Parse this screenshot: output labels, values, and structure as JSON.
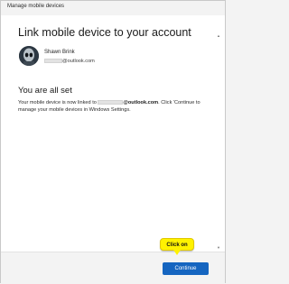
{
  "window": {
    "title": "Manage mobile devices"
  },
  "main": {
    "heading": "Link mobile device to your account",
    "account": {
      "name": "Shawn Brink",
      "email_domain": "@outlook.com"
    },
    "status_heading": "You are all set",
    "message": {
      "part1": "Your mobile device is now linked to ",
      "email_domain": "@outlook.com",
      "part2": ". Click 'Continue to manage your mobile devices in Windows Settings."
    }
  },
  "footer": {
    "continue_label": "Continue"
  },
  "annotation": {
    "callout_label": "Click on"
  },
  "colors": {
    "accent": "#1565c0",
    "callout": "#fff200"
  }
}
